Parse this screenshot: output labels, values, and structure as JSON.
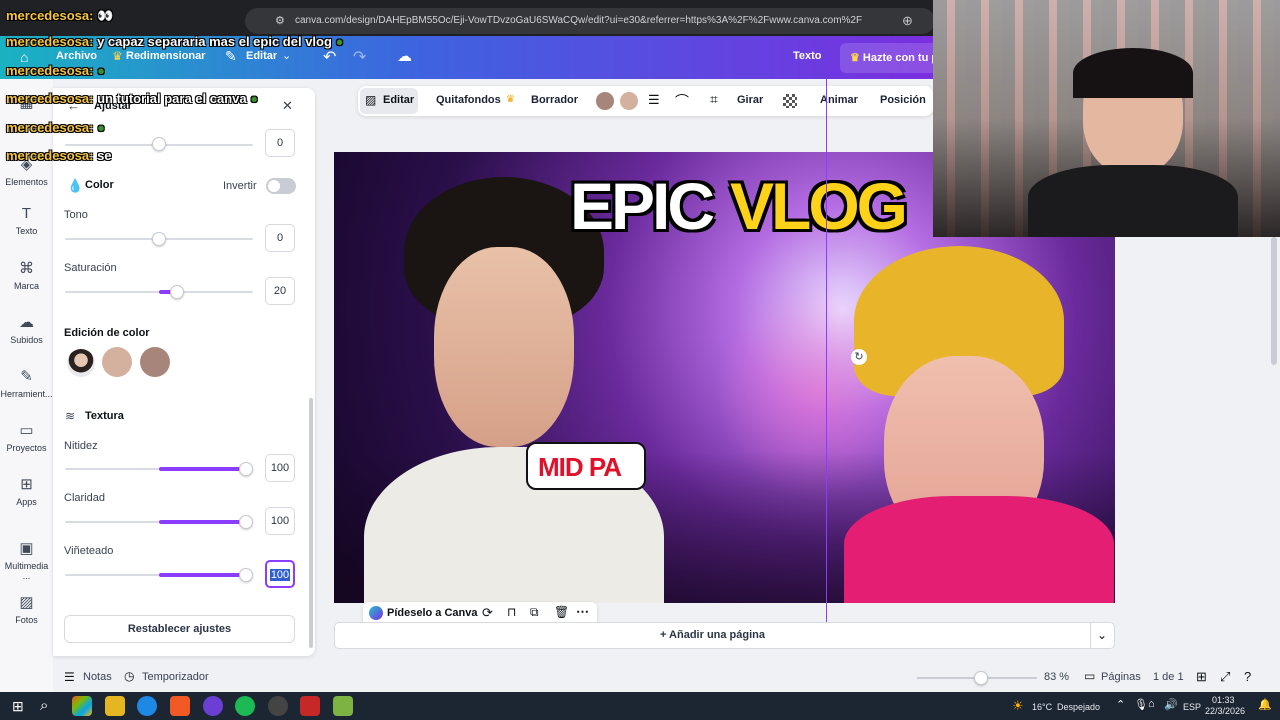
{
  "browser": {
    "url": "canva.com/design/DAHEpBM55Oc/Eji-VowTDvzoGaU6SWaCQw/edit?ui=e30&referrer=https%3A%2F%2Fwww.canva.com%2F"
  },
  "header": {
    "menu": [
      "Archivo",
      "Redimensionar",
      "Editar"
    ],
    "texto_label": "Texto",
    "pro_button": "Hazte con tu p"
  },
  "chat": [
    {
      "user": "mercedesosa:",
      "message": "👀"
    },
    {
      "user": "mercedesosa:",
      "message": "y capaz separaria mas el epic del vlog"
    },
    {
      "user": "mercedesosa:",
      "message": ""
    },
    {
      "user": "mercedesosa:",
      "message": "un tutorial para el canva"
    },
    {
      "user": "mercedesosa:",
      "message": ""
    },
    {
      "user": "mercedesosa:",
      "message": "se"
    }
  ],
  "rail": {
    "items": [
      {
        "label": "Elementos",
        "icon": "shapes-icon"
      },
      {
        "label": "Texto",
        "icon": "text-icon"
      },
      {
        "label": "Marca",
        "icon": "brand-icon"
      },
      {
        "label": "Subidos",
        "icon": "upload-icon"
      },
      {
        "label": "Herramient...",
        "icon": "tools-icon"
      },
      {
        "label": "Proyectos",
        "icon": "folder-icon"
      },
      {
        "label": "Apps",
        "icon": "apps-icon"
      },
      {
        "label": "Multimedia ...",
        "icon": "media-icon"
      },
      {
        "label": "Fotos",
        "icon": "photo-icon"
      }
    ]
  },
  "panel": {
    "title": "Ajustar",
    "top_value": "0",
    "color_heading": "Color",
    "invert_label": "Invertir",
    "sliders_color": [
      {
        "label": "Tono",
        "value": "0"
      },
      {
        "label": "Saturación",
        "value": "20"
      }
    ],
    "color_edit_heading": "Edición de color",
    "swatches": [
      "#d4b19f",
      "#a7857a"
    ],
    "texture_heading": "Textura",
    "sliders_texture": [
      {
        "label": "Nitidez",
        "value": "100"
      },
      {
        "label": "Claridad",
        "value": "100"
      },
      {
        "label": "Viñeteado",
        "value": "100"
      }
    ],
    "reset_button": "Restablecer ajustes"
  },
  "toolbar": {
    "edit": "Editar",
    "bg_remover": "Quitafondos",
    "eraser": "Borrador",
    "colors": [
      "#a7857a",
      "#d4b19f"
    ],
    "flip": "Girar",
    "animate": "Animar",
    "position": "Posición"
  },
  "canvas": {
    "title_left": "EPIC",
    "title_right": "VLOG",
    "bubble": "MID PA"
  },
  "canvas_actions": {
    "ask_canva": "Pídeselo a Canva"
  },
  "add_page": "+ Añadir una página",
  "bottom": {
    "notes": "Notas",
    "timer": "Temporizador",
    "zoom": "83 %",
    "pages_label": "Páginas",
    "page_count": "1 de 1"
  },
  "taskbar": {
    "weather_temp": "16°C",
    "weather_desc": "Despejado",
    "lang": "ESP",
    "time": "01:33",
    "date": "22/3/2026"
  }
}
